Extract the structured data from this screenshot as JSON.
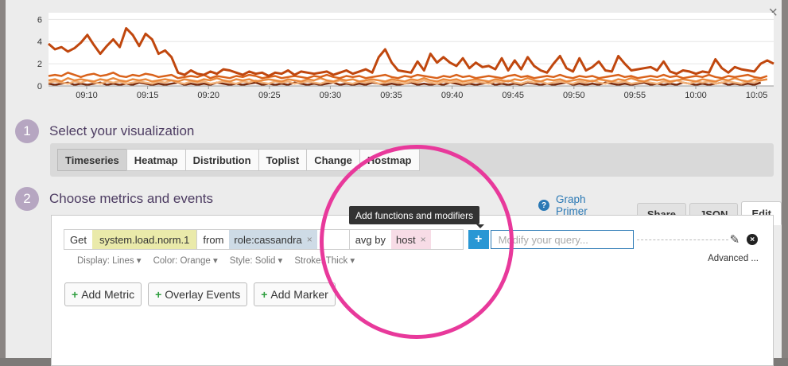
{
  "colors": {
    "accent": "#2997d4",
    "highlight": "#e8399b",
    "step": "#b6a6c1",
    "metric_chip": "#eaeaaa",
    "tag_chip": "#cedbe6",
    "group_chip": "#f7dce6"
  },
  "close_icon": "×",
  "chart_data": {
    "type": "line",
    "y_ticks": [
      "6",
      "4",
      "2",
      "0"
    ],
    "ylim": [
      0,
      6.6
    ],
    "x_ticks": [
      "09:10",
      "09:15",
      "09:20",
      "09:25",
      "09:30",
      "09:35",
      "09:40",
      "09:45",
      "09:50",
      "09:55",
      "10:00",
      "10:05"
    ],
    "series": [
      {
        "color": "#c0470e",
        "values": [
          3.8,
          3.3,
          3.5,
          3.1,
          3.4,
          3.9,
          4.6,
          3.7,
          2.9,
          3.6,
          4.2,
          3.5,
          5.2,
          4.6,
          3.6,
          4.7,
          4.2,
          2.9,
          3.2,
          2.6,
          1.2,
          1.0,
          1.4,
          1.1,
          1.0,
          1.3,
          1.1,
          1.5,
          1.4,
          1.2,
          1.0,
          1.3,
          1.1,
          1.2,
          0.9,
          1.2,
          1.1,
          1.4,
          1.0,
          1.3,
          1.2,
          1.1,
          1.2,
          1.3,
          1.0,
          1.2,
          1.4,
          1.1,
          1.3,
          1.5,
          1.2,
          2.6,
          3.3,
          2.1,
          1.4,
          1.3,
          1.2,
          2.2,
          1.4,
          2.9,
          2.1,
          2.6,
          2.1,
          1.8,
          2.5,
          1.6,
          2.1,
          1.7,
          1.8,
          1.5,
          2.5,
          1.4,
          2.3,
          1.5,
          2.6,
          1.8,
          1.4,
          1.2,
          2.0,
          2.7,
          1.6,
          1.3,
          2.5,
          1.4,
          1.7,
          2.2,
          1.4,
          1.3,
          2.7,
          2.0,
          1.4,
          1.5,
          1.6,
          1.7,
          1.4,
          2.2,
          1.3,
          1.1,
          1.4,
          1.3,
          1.1,
          1.3,
          1.2,
          2.4,
          1.6,
          1.2,
          1.7,
          1.5,
          1.4,
          1.3,
          2.0,
          2.3,
          2.0
        ]
      },
      {
        "color": "#d9621b",
        "values": [
          0.9,
          1.0,
          0.9,
          1.2,
          1.0,
          0.8,
          1.0,
          1.1,
          0.9,
          1.0,
          1.2,
          0.9,
          0.8,
          1.0,
          0.9,
          1.1,
          1.0,
          0.8,
          0.9,
          1.0,
          0.7,
          0.8,
          0.9,
          0.8,
          1.0,
          0.7,
          0.9,
          0.8,
          0.7,
          0.9,
          0.8,
          1.0,
          0.9,
          0.7,
          0.8,
          0.9,
          0.7,
          0.8,
          0.9,
          0.8,
          0.7,
          0.9,
          0.8,
          1.0,
          0.8,
          0.7,
          0.9,
          0.8,
          0.9,
          0.7,
          0.8,
          0.9,
          1.0,
          0.8,
          0.7,
          0.9,
          0.8,
          1.0,
          0.9,
          0.8,
          0.7,
          0.9,
          0.8,
          1.0,
          0.8,
          0.9,
          0.7,
          0.8,
          0.9,
          0.8,
          0.7,
          0.9,
          1.0,
          0.8,
          0.9,
          0.7,
          0.8,
          0.9,
          0.8,
          1.0,
          0.8,
          0.7,
          0.9,
          0.8,
          0.9,
          0.7,
          0.8,
          0.9,
          1.0,
          0.8,
          0.9,
          0.7,
          0.8,
          0.9,
          0.8,
          1.0,
          0.8,
          0.9,
          0.7,
          0.8,
          0.9,
          0.8,
          1.0,
          0.8,
          0.7,
          0.9,
          0.8,
          0.9,
          1.0,
          0.8,
          0.7,
          0.9
        ]
      },
      {
        "color": "#e98a3f",
        "values": [
          0.5,
          0.6,
          0.4,
          0.7,
          0.5,
          0.6,
          0.5,
          0.4,
          0.6,
          0.5,
          0.7,
          0.5,
          0.4,
          0.6,
          0.5,
          0.6,
          0.4,
          0.5,
          0.6,
          0.5,
          0.4,
          0.6,
          0.5,
          0.4,
          0.6,
          0.5,
          0.7,
          0.5,
          0.4,
          0.6,
          0.5,
          0.6,
          0.4,
          0.5,
          0.6,
          0.5,
          0.4,
          0.6,
          0.5,
          0.4,
          0.6,
          0.5,
          0.7,
          0.5,
          0.4,
          0.6,
          0.5,
          0.6,
          0.4,
          0.5,
          0.6,
          0.5,
          0.4,
          0.6,
          0.5,
          0.4,
          0.6,
          0.5,
          0.7,
          0.5,
          0.4,
          0.6,
          0.5,
          0.6,
          0.4,
          0.5,
          0.6,
          0.5,
          0.4,
          0.6,
          0.5,
          0.4,
          0.6,
          0.5,
          0.7,
          0.5,
          0.4,
          0.6,
          0.5,
          0.6,
          0.4,
          0.5,
          0.6,
          0.5,
          0.4,
          0.6,
          0.5,
          0.4,
          0.6,
          0.5,
          0.7,
          0.5,
          0.4,
          0.6,
          0.5,
          0.6,
          0.4,
          0.5,
          0.6,
          0.5,
          0.4,
          0.6,
          0.5,
          0.4,
          0.6,
          0.5,
          0.7,
          0.5,
          0.4,
          0.6,
          0.5,
          0.6
        ]
      },
      {
        "color": "#f2b27a",
        "values": [
          0.3,
          0.4,
          0.3,
          0.2,
          0.4,
          0.3,
          0.5,
          0.3,
          0.2,
          0.4,
          0.3,
          0.4,
          0.2,
          0.3,
          0.4,
          0.3,
          0.2,
          0.4,
          0.3,
          0.5,
          0.3,
          0.2,
          0.4,
          0.3,
          0.4,
          0.2,
          0.3,
          0.4,
          0.3,
          0.2,
          0.4,
          0.3,
          0.5,
          0.3,
          0.2,
          0.4,
          0.3,
          0.4,
          0.2,
          0.3,
          0.4,
          0.3,
          0.2,
          0.4,
          0.3,
          0.5,
          0.3,
          0.2,
          0.4,
          0.3,
          0.4,
          0.2,
          0.3,
          0.4,
          0.3,
          0.2,
          0.4,
          0.3,
          0.5,
          0.3,
          0.2,
          0.4,
          0.3,
          0.4,
          0.2,
          0.3,
          0.4,
          0.3,
          0.2,
          0.4,
          0.3,
          0.5,
          0.3,
          0.2,
          0.4,
          0.3,
          0.4,
          0.2,
          0.3,
          0.4,
          0.3,
          0.2,
          0.4,
          0.3,
          0.5,
          0.3,
          0.2,
          0.4,
          0.3,
          0.4,
          0.2,
          0.3,
          0.4,
          0.3,
          0.2,
          0.4,
          0.3,
          0.5,
          0.3,
          0.2,
          0.4,
          0.3,
          0.4,
          0.2,
          0.3,
          0.4,
          0.3,
          0.2,
          0.4,
          0.3,
          0.5
        ]
      },
      {
        "color": "#7a2a0c",
        "values": [
          0.2,
          0.1,
          0.2,
          0.3,
          0.1,
          0.2,
          0.1,
          0.2,
          0.3,
          0.1,
          0.2,
          0.1,
          0.2,
          0.1,
          0.3,
          0.2,
          0.1,
          0.2,
          0.1,
          0.2,
          0.3,
          0.1,
          0.2,
          0.1,
          0.2,
          0.1,
          0.3,
          0.2,
          0.1,
          0.2,
          0.1,
          0.2,
          0.3,
          0.1,
          0.2,
          0.1,
          0.2,
          0.1,
          0.3,
          0.2,
          0.1,
          0.2,
          0.1,
          0.2,
          0.3,
          0.1,
          0.2,
          0.1,
          0.2,
          0.1,
          0.3,
          0.2,
          0.1,
          0.2,
          0.1,
          0.2,
          0.3,
          0.1,
          0.2,
          0.1,
          0.2,
          0.1,
          0.3,
          0.2,
          0.1,
          0.2,
          0.1,
          0.2,
          0.3,
          0.1,
          0.2,
          0.1,
          0.2,
          0.1,
          0.3,
          0.2,
          0.1,
          0.2,
          0.1,
          0.2,
          0.3,
          0.1,
          0.2,
          0.1,
          0.2,
          0.1,
          0.3,
          0.2,
          0.1,
          0.2,
          0.1,
          0.2,
          0.3,
          0.1,
          0.2,
          0.1,
          0.2,
          0.1,
          0.3,
          0.2,
          0.1,
          0.2,
          0.1,
          0.2,
          0.3,
          0.1,
          0.2,
          0.1,
          0.2,
          0.1,
          0.3
        ]
      }
    ]
  },
  "step1": {
    "number": "1",
    "title": "Select your visualization"
  },
  "viz_tabs": [
    "Timeseries",
    "Heatmap",
    "Distribution",
    "Toplist",
    "Change",
    "Hostmap"
  ],
  "step2": {
    "number": "2",
    "title": "Choose metrics and events"
  },
  "graph_primer": {
    "icon": "?",
    "label": "Graph Primer"
  },
  "editor_tabs": {
    "share": "Share",
    "json": "JSON",
    "edit": "Edit"
  },
  "query": {
    "get_label": "Get",
    "metric": "system.load.norm.1",
    "from_label": "from",
    "from_tag": "role:cassandra",
    "avg_label": "avg by",
    "group_tag": "host",
    "remove_icon": "×",
    "plus_label": "+",
    "placeholder": "Modify your query...",
    "edit_icon": "✎",
    "delete_icon": "×"
  },
  "options": {
    "display_label": "Display:",
    "display_value": "Lines ▾",
    "color_label": "Color:",
    "color_value": "Orange ▾",
    "style_label": "Style:",
    "style_value": "Solid ▾",
    "stroke_label": "Stroke:",
    "stroke_value": "Thick ▾",
    "advanced": "Advanced ..."
  },
  "actions": {
    "plus": "+",
    "add_metric": "Add Metric",
    "overlay_events": "Overlay Events",
    "add_marker": "Add Marker"
  },
  "tooltip": "Add functions and modifiers"
}
